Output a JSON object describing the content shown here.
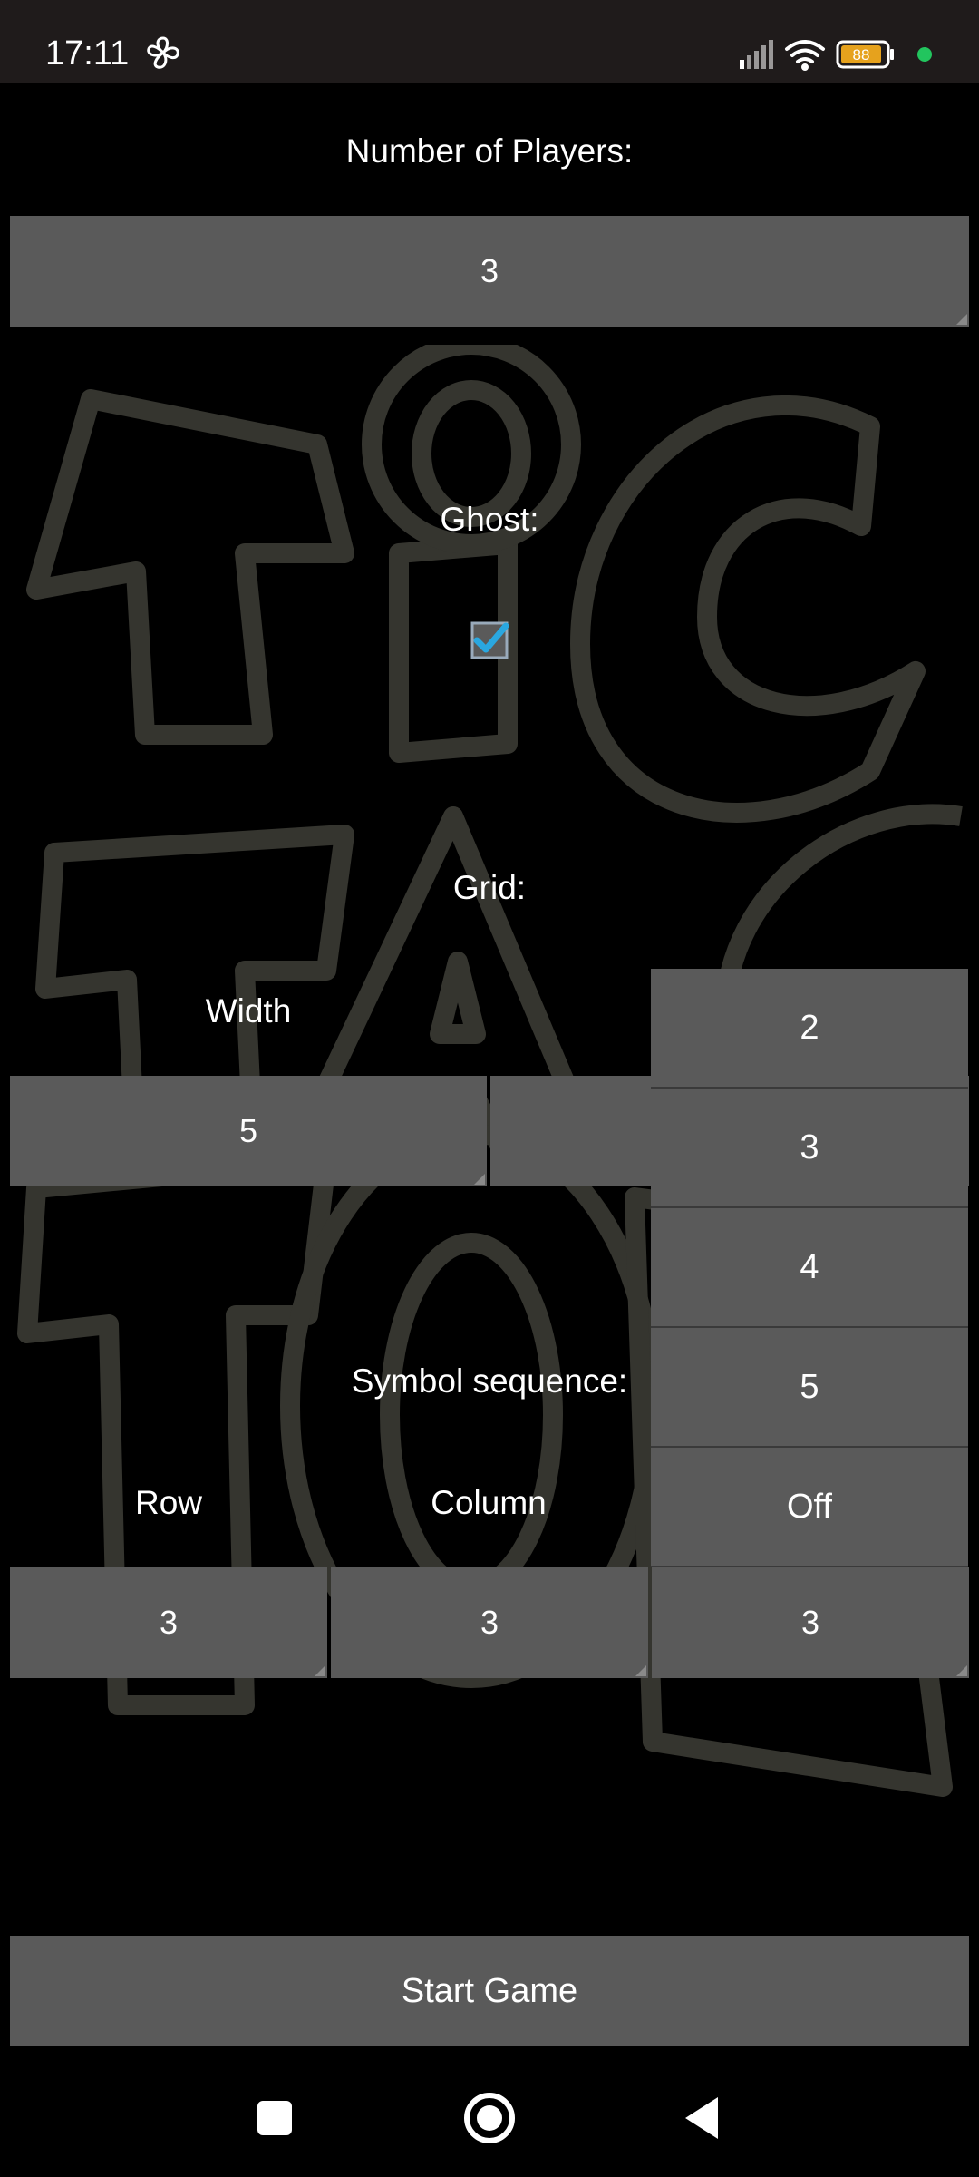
{
  "status_bar": {
    "time": "17:11",
    "battery": "88"
  },
  "players": {
    "label": "Number of Players:",
    "value": "3"
  },
  "ghost": {
    "label": "Ghost:",
    "checked": true
  },
  "grid": {
    "label": "Grid:",
    "width_label": "Width",
    "width_value": "5"
  },
  "dropdown": {
    "options": [
      "2",
      "3",
      "4",
      "5",
      "Off"
    ]
  },
  "symbol_sequence": {
    "label": "Symbol sequence:",
    "row_label": "Row",
    "row_value": "3",
    "column_label": "Column",
    "column_value": "3",
    "third_value": "3"
  },
  "start_button_label": "Start Game",
  "colors": {
    "field_bg": "#5a5a5a",
    "background": "#000000",
    "logo_outline": "#35352f",
    "checkbox_accent": "#2aa7e0"
  }
}
